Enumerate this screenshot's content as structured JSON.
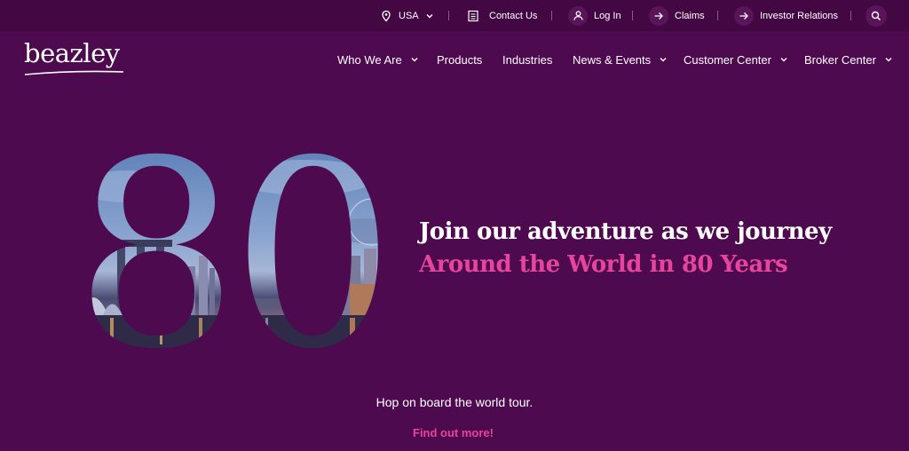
{
  "utility_bar": {
    "region": "USA",
    "contact": "Contact Us",
    "login": "Log In",
    "claims": "Claims",
    "investor": "Investor Relations"
  },
  "brand": {
    "name": "beazley"
  },
  "nav": {
    "items": [
      {
        "label": "Who We Are",
        "dropdown": true
      },
      {
        "label": "Products",
        "dropdown": false
      },
      {
        "label": "Industries",
        "dropdown": false
      },
      {
        "label": "News & Events",
        "dropdown": true
      },
      {
        "label": "Customer Center",
        "dropdown": true
      },
      {
        "label": "Broker Center",
        "dropdown": true
      }
    ]
  },
  "hero": {
    "big_number": "80",
    "headline_line1": "Join our adventure as we journey",
    "headline_line2": "Around the World in 80 Years",
    "tagline": "Hop on board the world tour.",
    "cta": "Find out more!"
  },
  "colors": {
    "background": "#4e0a4e",
    "topbar": "#430843",
    "accent_pink": "#e7449e"
  }
}
